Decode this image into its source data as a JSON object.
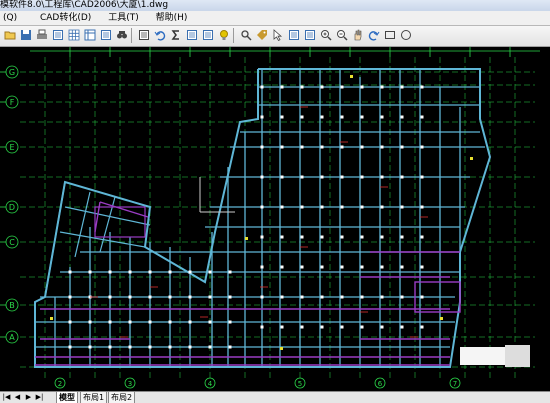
{
  "window": {
    "title": "模软件8.0\\工程库\\CAD2006\\大厦\\1.dwg"
  },
  "menu": [
    {
      "label": "(Q)"
    },
    {
      "label": "CAD转化(D)"
    },
    {
      "label": "工具(T)"
    },
    {
      "label": "帮助(H)"
    }
  ],
  "toolbar": {
    "buttons": [
      {
        "name": "open-file",
        "icon": "folder-icon",
        "color": "#3a6fb0"
      },
      {
        "name": "save-file",
        "icon": "save-icon",
        "color": "#3a6fb0"
      },
      {
        "name": "print",
        "icon": "print-icon",
        "color": "#3a6fb0"
      },
      {
        "name": "layer",
        "icon": "layer-icon",
        "color": "#3a6fb0"
      },
      {
        "name": "grid",
        "icon": "grid-icon",
        "color": "#3a6fb0"
      },
      {
        "name": "table",
        "icon": "table-icon",
        "color": "#3a6fb0"
      },
      {
        "name": "properties",
        "icon": "list-icon",
        "color": "#3a6fb0"
      },
      {
        "name": "binoculars",
        "icon": "binoculars-icon",
        "color": "#444444"
      },
      {
        "name": "measure",
        "icon": "measure-icon",
        "color": "#444444"
      },
      {
        "name": "undo",
        "icon": "undo-icon",
        "color": "#2a6ac0"
      },
      {
        "name": "sum",
        "icon": "sigma-icon",
        "color": "#333333"
      },
      {
        "name": "calculate",
        "icon": "calculator-icon",
        "color": "#3a6fb0"
      },
      {
        "name": "export",
        "icon": "export-icon",
        "color": "#3a6fb0"
      },
      {
        "name": "idea",
        "icon": "lightbulb-icon",
        "color": "#e2c400"
      },
      {
        "name": "search",
        "icon": "search-icon",
        "color": "#444444"
      },
      {
        "name": "tag",
        "icon": "tag-icon",
        "color": "#c89a30"
      },
      {
        "name": "pointer",
        "icon": "pointer-icon",
        "color": "#444444"
      },
      {
        "name": "columns",
        "icon": "columns-icon",
        "color": "#3a6fb0"
      },
      {
        "name": "rows",
        "icon": "rows-icon",
        "color": "#3a6fb0"
      },
      {
        "name": "zoom-in",
        "icon": "zoom-in-icon",
        "color": "#444444"
      },
      {
        "name": "zoom-out",
        "icon": "zoom-out-icon",
        "color": "#444444"
      },
      {
        "name": "pan",
        "icon": "hand-icon",
        "color": "#444444"
      },
      {
        "name": "redraw",
        "icon": "redraw-icon",
        "color": "#2a6ac0"
      },
      {
        "name": "rectangle",
        "icon": "rectangle-icon",
        "color": "#444444"
      },
      {
        "name": "circle",
        "icon": "circle-icon",
        "color": "#444444"
      }
    ]
  },
  "drawing": {
    "background": "#000000",
    "colors": {
      "axis": "#2bd94a",
      "wall": "#5fb6d6",
      "column": "#ffffff",
      "beam": "#9a3cc4",
      "red": "#e03030",
      "yellow": "#e8e030"
    },
    "axis_labels_left": [
      "G",
      "F",
      "E",
      "D",
      "C",
      "B",
      "A"
    ],
    "axis_labels_bottom": [
      "2",
      "3",
      "4",
      "5",
      "6",
      "7"
    ]
  },
  "tabs": {
    "nav": [
      "|◀",
      "◀",
      "▶",
      "▶|"
    ],
    "items": [
      {
        "label": "模型",
        "active": true
      },
      {
        "label": "布局1",
        "active": false
      },
      {
        "label": "布局2",
        "active": false
      }
    ]
  }
}
